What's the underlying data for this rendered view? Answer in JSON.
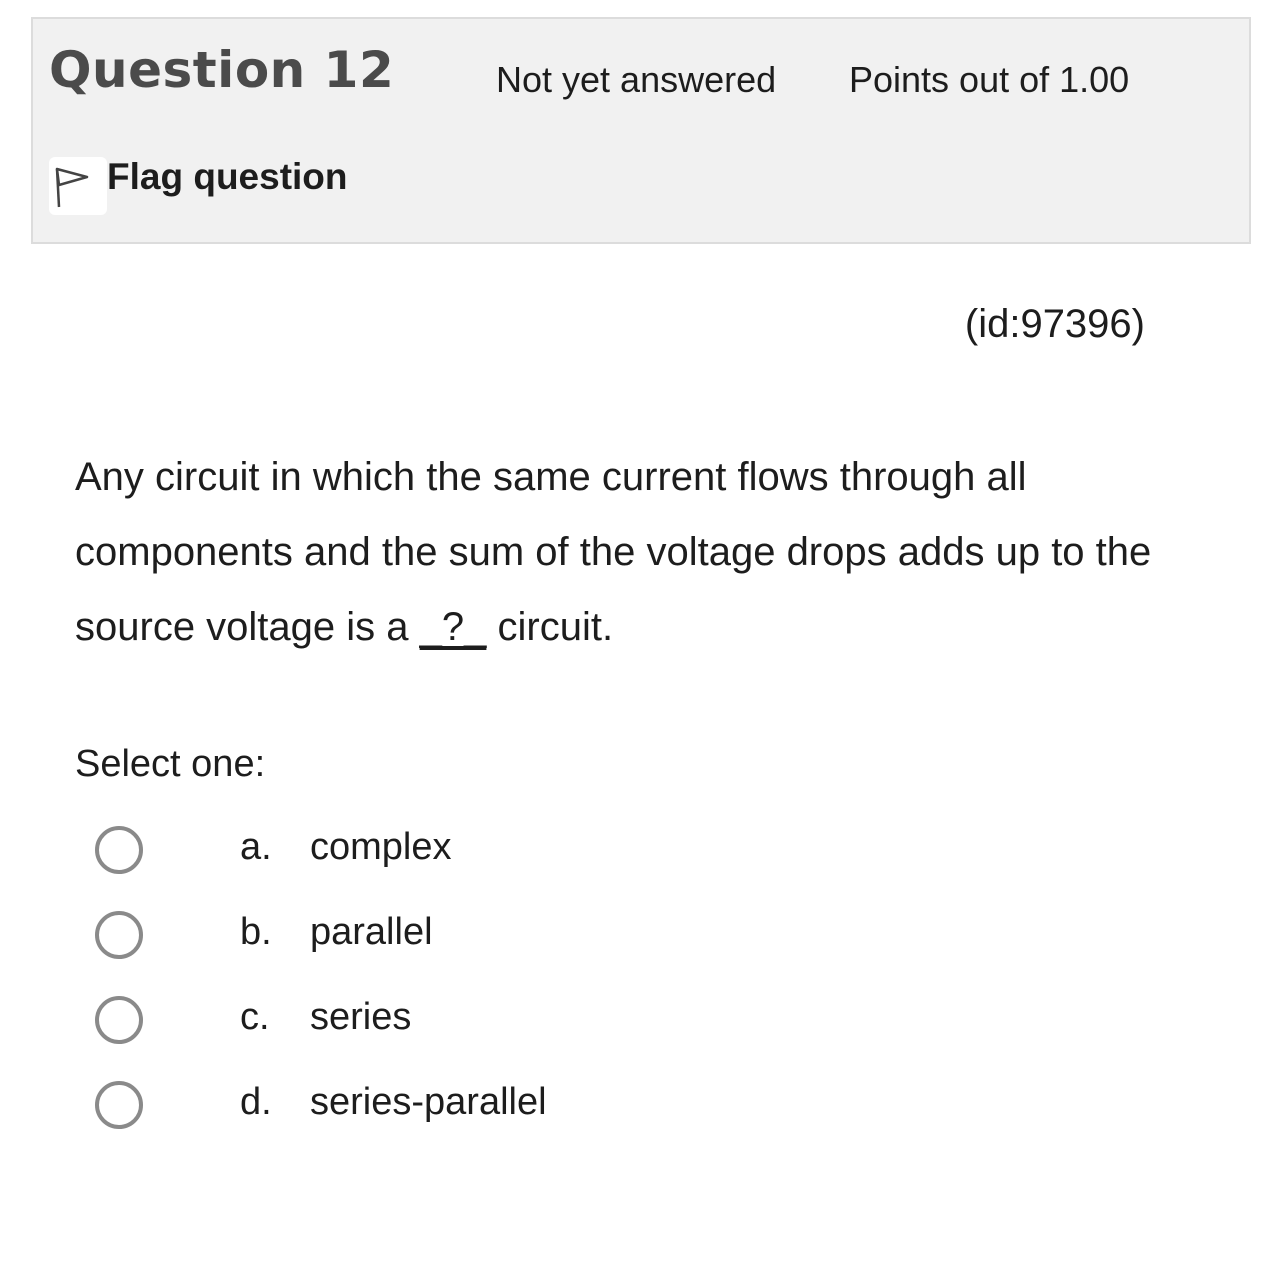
{
  "info": {
    "title": "Question 12",
    "state": "Not yet answered",
    "grade": "Points out of 1.00",
    "flag_label": "Flag question",
    "flag_icon": "flag-outline-icon"
  },
  "question": {
    "id_label": "(id:97396)",
    "text_before": "Any circuit in which the same current flows through all components and the sum of the voltage drops adds up to the source voltage is a ",
    "blank": "_?_",
    "text_after": " circuit.",
    "prompt": "Select one:"
  },
  "answers": [
    {
      "letter": "a.",
      "text": "complex",
      "selected": false
    },
    {
      "letter": "b.",
      "text": "parallel",
      "selected": false
    },
    {
      "letter": "c.",
      "text": "series",
      "selected": false
    },
    {
      "letter": "d.",
      "text": "series-parallel",
      "selected": false
    }
  ]
}
